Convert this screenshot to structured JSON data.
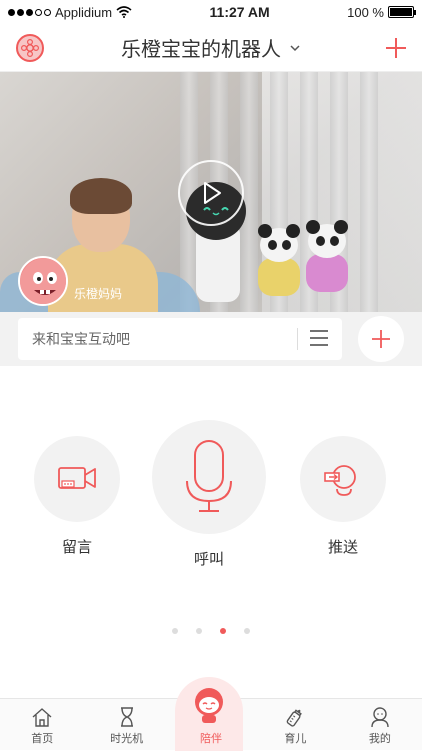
{
  "status_bar": {
    "carrier": "Applidium",
    "time": "11:27 AM",
    "battery": "100 %",
    "battery_level": 1.0
  },
  "nav": {
    "title": "乐橙宝宝的机器人",
    "avatar_icon": "flower-avatar-icon",
    "add_icon": "plus-icon"
  },
  "video": {
    "owner_name": "乐橙妈妈",
    "play_icon": "play-icon"
  },
  "message_input": {
    "placeholder": "来和宝宝互动吧"
  },
  "actions": [
    {
      "label": "留言",
      "icon": "video-message-icon"
    },
    {
      "label": "呼叫",
      "icon": "microphone-icon"
    },
    {
      "label": "推送",
      "icon": "push-icon"
    }
  ],
  "pager": {
    "count": 4,
    "active_index": 2
  },
  "tabs": [
    {
      "label": "首页",
      "icon": "home-icon"
    },
    {
      "label": "时光机",
      "icon": "hourglass-icon"
    },
    {
      "label": "陪伴",
      "icon": "companion-robot-icon"
    },
    {
      "label": "育儿",
      "icon": "baby-bottle-icon"
    },
    {
      "label": "我的",
      "icon": "profile-icon"
    }
  ],
  "colors": {
    "accent": "#f05a5a",
    "background": "#ffffff",
    "input_bar": "#f2f2f2"
  }
}
